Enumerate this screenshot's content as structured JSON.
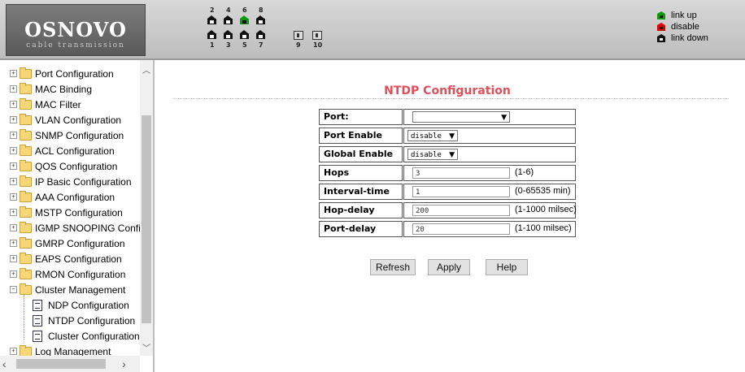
{
  "header": {
    "logo_title": "OSNOVO",
    "logo_subtitle": "cable transmission",
    "port_numbers_top": [
      "2",
      "4",
      "6",
      "8"
    ],
    "port_numbers_bottom": [
      "1",
      "3",
      "5",
      "7",
      "9",
      "10"
    ],
    "port_status_top": [
      "down",
      "down",
      "up",
      "down"
    ],
    "port_status_bottom": [
      "down",
      "down",
      "down",
      "down"
    ],
    "legend": [
      {
        "label": "link up",
        "color": "#0a9a0a"
      },
      {
        "label": "disable",
        "color": "#e00000"
      },
      {
        "label": "link down",
        "color": "#111111"
      }
    ]
  },
  "sidebar": {
    "items": [
      {
        "label": "Port Configuration"
      },
      {
        "label": "MAC Binding"
      },
      {
        "label": "MAC Filter"
      },
      {
        "label": "VLAN Configuration"
      },
      {
        "label": "SNMP Configuration"
      },
      {
        "label": "ACL Configuration"
      },
      {
        "label": "QOS Configuration"
      },
      {
        "label": "IP Basic Configuration"
      },
      {
        "label": "AAA Configuration"
      },
      {
        "label": "MSTP Configuration"
      },
      {
        "label": "IGMP SNOOPING Confi"
      },
      {
        "label": "GMRP Configuration"
      },
      {
        "label": "EAPS Configuration"
      },
      {
        "label": "RMON Configuration"
      },
      {
        "label": "Cluster Management"
      },
      {
        "label": "NDP Configuration"
      },
      {
        "label": "NTDP Configuration"
      },
      {
        "label": "Cluster Configuration"
      },
      {
        "label": "Log Management"
      }
    ]
  },
  "main": {
    "title": "NTDP Configuration",
    "form": {
      "port_label": "Port:",
      "port_value": "",
      "port_enable_label": "Port Enable",
      "port_enable_value": "disable",
      "global_enable_label": "Global Enable",
      "global_enable_value": "disable",
      "hops_label": "Hops",
      "hops_value": "3",
      "hops_hint": "(1-6)",
      "interval_label": "Interval-time",
      "interval_value": "1",
      "interval_hint": "(0-65535 min)",
      "hop_delay_label": "Hop-delay",
      "hop_delay_value": "200",
      "hop_delay_hint": "(1-1000 milsec)",
      "port_delay_label": "Port-delay",
      "port_delay_value": "20",
      "port_delay_hint": "(1-100 milsec)"
    },
    "buttons": {
      "refresh": "Refresh",
      "apply": "Apply",
      "help": "Help"
    }
  }
}
